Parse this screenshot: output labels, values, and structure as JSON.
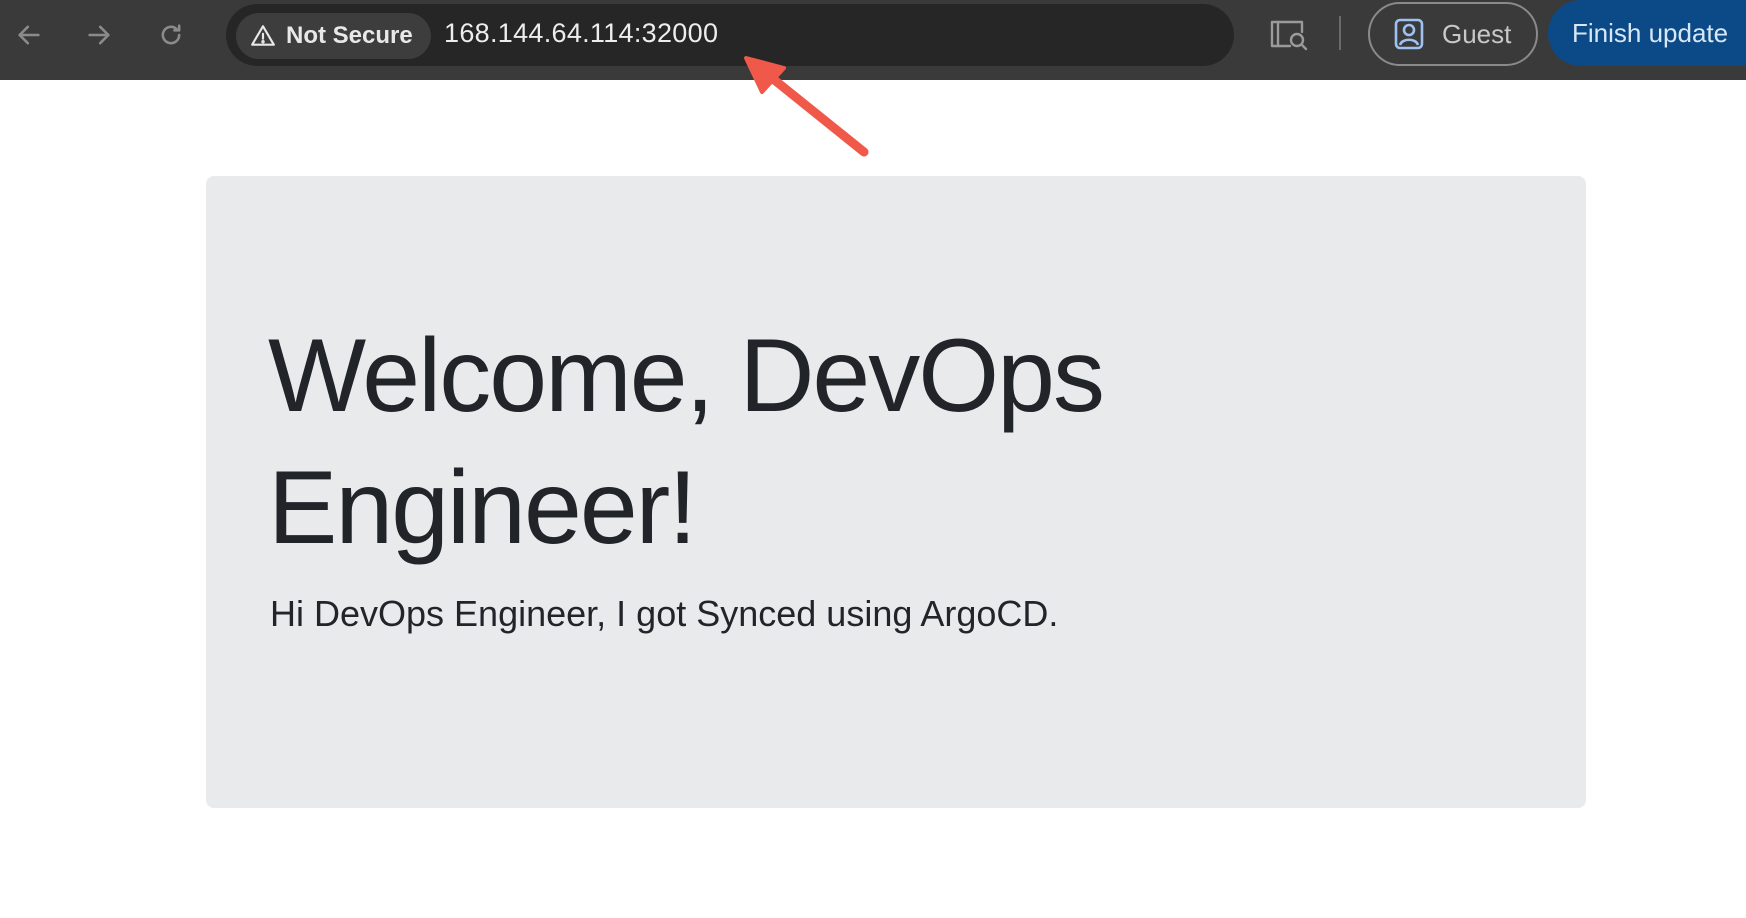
{
  "browser": {
    "security_label": "Not Secure",
    "url": "168.144.64.114:32000",
    "profile_label": "Guest",
    "update_label": "Finish update",
    "icons": {
      "back": "back-arrow-icon",
      "forward": "forward-arrow-icon",
      "reload": "reload-icon",
      "warning": "warning-triangle-icon",
      "search_page": "search-page-icon",
      "profile": "profile-icon"
    },
    "colors": {
      "toolbar": "#3a3a3a",
      "omnibox": "#262626",
      "update_button": "#0b4a86",
      "annotation_arrow": "#f0584a"
    }
  },
  "page": {
    "heading": "Welcome, DevOps Engineer!",
    "message": "Hi DevOps Engineer, I got Synced using ArgoCD.",
    "colors": {
      "card_background": "#e9eaec",
      "text": "#212529"
    }
  }
}
